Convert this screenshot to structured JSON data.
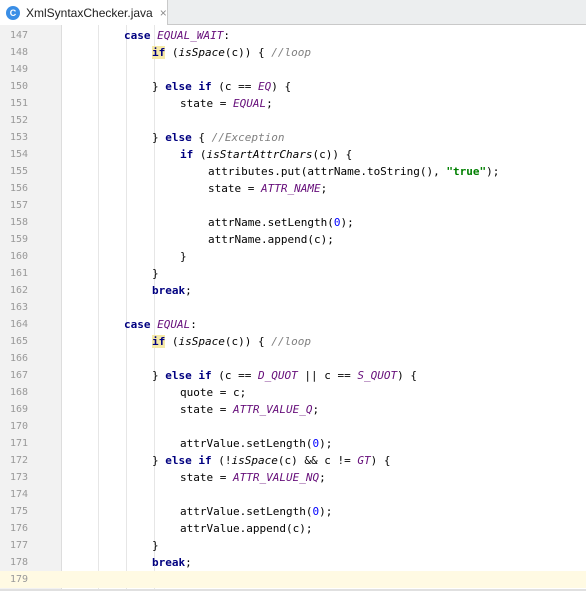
{
  "tab": {
    "label": "XmlSyntaxChecker.java",
    "icon_letter": "C",
    "close": "×"
  },
  "lines": [
    {
      "n": "147",
      "indent": 4,
      "tokens": [
        {
          "t": "kw",
          "v": "case "
        },
        {
          "t": "const",
          "v": "EQUAL_WAIT"
        },
        {
          "t": "p",
          "v": ":"
        }
      ]
    },
    {
      "n": "148",
      "indent": 5,
      "tokens": [
        {
          "t": "kwhl",
          "v": "if"
        },
        {
          "t": "p",
          "v": " ("
        },
        {
          "t": "fn",
          "v": "isSpace"
        },
        {
          "t": "p",
          "v": "(c)) { "
        },
        {
          "t": "cmt",
          "v": "//loop"
        }
      ]
    },
    {
      "n": "149",
      "indent": 0,
      "tokens": []
    },
    {
      "n": "150",
      "indent": 5,
      "tokens": [
        {
          "t": "p",
          "v": "} "
        },
        {
          "t": "kw",
          "v": "else if"
        },
        {
          "t": "p",
          "v": " (c == "
        },
        {
          "t": "const",
          "v": "EQ"
        },
        {
          "t": "p",
          "v": ") {"
        }
      ]
    },
    {
      "n": "151",
      "indent": 6,
      "tokens": [
        {
          "t": "p",
          "v": "state = "
        },
        {
          "t": "const",
          "v": "EQUAL"
        },
        {
          "t": "p",
          "v": ";"
        }
      ]
    },
    {
      "n": "152",
      "indent": 0,
      "tokens": []
    },
    {
      "n": "153",
      "indent": 5,
      "tokens": [
        {
          "t": "p",
          "v": "} "
        },
        {
          "t": "kw",
          "v": "else"
        },
        {
          "t": "p",
          "v": " { "
        },
        {
          "t": "cmt",
          "v": "//Exception"
        }
      ]
    },
    {
      "n": "154",
      "indent": 6,
      "tokens": [
        {
          "t": "kw",
          "v": "if"
        },
        {
          "t": "p",
          "v": " ("
        },
        {
          "t": "fn",
          "v": "isStartAttrChars"
        },
        {
          "t": "p",
          "v": "(c)) {"
        }
      ]
    },
    {
      "n": "155",
      "indent": 7,
      "tokens": [
        {
          "t": "p",
          "v": "attributes.put(attrName.toString(), "
        },
        {
          "t": "str",
          "v": "\"true\""
        },
        {
          "t": "p",
          "v": ");"
        }
      ]
    },
    {
      "n": "156",
      "indent": 7,
      "tokens": [
        {
          "t": "p",
          "v": "state = "
        },
        {
          "t": "const",
          "v": "ATTR_NAME"
        },
        {
          "t": "p",
          "v": ";"
        }
      ]
    },
    {
      "n": "157",
      "indent": 0,
      "tokens": []
    },
    {
      "n": "158",
      "indent": 7,
      "tokens": [
        {
          "t": "p",
          "v": "attrName.setLength("
        },
        {
          "t": "num",
          "v": "0"
        },
        {
          "t": "p",
          "v": ");"
        }
      ]
    },
    {
      "n": "159",
      "indent": 7,
      "tokens": [
        {
          "t": "p",
          "v": "attrName.append(c);"
        }
      ]
    },
    {
      "n": "160",
      "indent": 6,
      "tokens": [
        {
          "t": "p",
          "v": "}"
        }
      ]
    },
    {
      "n": "161",
      "indent": 5,
      "tokens": [
        {
          "t": "p",
          "v": "}"
        }
      ]
    },
    {
      "n": "162",
      "indent": 5,
      "tokens": [
        {
          "t": "kw",
          "v": "break"
        },
        {
          "t": "p",
          "v": ";"
        }
      ]
    },
    {
      "n": "163",
      "indent": 0,
      "tokens": []
    },
    {
      "n": "164",
      "indent": 4,
      "tokens": [
        {
          "t": "kw",
          "v": "case "
        },
        {
          "t": "const",
          "v": "EQUAL"
        },
        {
          "t": "p",
          "v": ":"
        }
      ]
    },
    {
      "n": "165",
      "indent": 5,
      "tokens": [
        {
          "t": "kwhl",
          "v": "if"
        },
        {
          "t": "p",
          "v": " ("
        },
        {
          "t": "fn",
          "v": "isSpace"
        },
        {
          "t": "p",
          "v": "(c)) { "
        },
        {
          "t": "cmt",
          "v": "//loop"
        }
      ]
    },
    {
      "n": "166",
      "indent": 0,
      "tokens": []
    },
    {
      "n": "167",
      "indent": 5,
      "tokens": [
        {
          "t": "p",
          "v": "} "
        },
        {
          "t": "kw",
          "v": "else if"
        },
        {
          "t": "p",
          "v": " (c == "
        },
        {
          "t": "const",
          "v": "D_QUOT"
        },
        {
          "t": "p",
          "v": " || c == "
        },
        {
          "t": "const",
          "v": "S_QUOT"
        },
        {
          "t": "p",
          "v": ") {"
        }
      ]
    },
    {
      "n": "168",
      "indent": 6,
      "tokens": [
        {
          "t": "p",
          "v": "quote = c;"
        }
      ]
    },
    {
      "n": "169",
      "indent": 6,
      "tokens": [
        {
          "t": "p",
          "v": "state = "
        },
        {
          "t": "const",
          "v": "ATTR_VALUE_Q"
        },
        {
          "t": "p",
          "v": ";"
        }
      ]
    },
    {
      "n": "170",
      "indent": 0,
      "tokens": []
    },
    {
      "n": "171",
      "indent": 6,
      "tokens": [
        {
          "t": "p",
          "v": "attrValue.setLength("
        },
        {
          "t": "num",
          "v": "0"
        },
        {
          "t": "p",
          "v": ");"
        }
      ]
    },
    {
      "n": "172",
      "indent": 5,
      "tokens": [
        {
          "t": "p",
          "v": "} "
        },
        {
          "t": "kw",
          "v": "else if"
        },
        {
          "t": "p",
          "v": " (!"
        },
        {
          "t": "fn",
          "v": "isSpace"
        },
        {
          "t": "p",
          "v": "(c) && c != "
        },
        {
          "t": "const",
          "v": "GT"
        },
        {
          "t": "p",
          "v": ") {"
        }
      ]
    },
    {
      "n": "173",
      "indent": 6,
      "tokens": [
        {
          "t": "p",
          "v": "state = "
        },
        {
          "t": "const",
          "v": "ATTR_VALUE_NQ"
        },
        {
          "t": "p",
          "v": ";"
        }
      ]
    },
    {
      "n": "174",
      "indent": 0,
      "tokens": []
    },
    {
      "n": "175",
      "indent": 6,
      "tokens": [
        {
          "t": "p",
          "v": "attrValue.setLength("
        },
        {
          "t": "num",
          "v": "0"
        },
        {
          "t": "p",
          "v": ");"
        }
      ]
    },
    {
      "n": "176",
      "indent": 6,
      "tokens": [
        {
          "t": "p",
          "v": "attrValue.append(c);"
        }
      ]
    },
    {
      "n": "177",
      "indent": 5,
      "tokens": [
        {
          "t": "p",
          "v": "}"
        }
      ]
    },
    {
      "n": "178",
      "indent": 5,
      "tokens": [
        {
          "t": "kw",
          "v": "break"
        },
        {
          "t": "p",
          "v": ";"
        }
      ]
    },
    {
      "n": "179",
      "indent": 0,
      "tokens": [],
      "current": true
    }
  ]
}
